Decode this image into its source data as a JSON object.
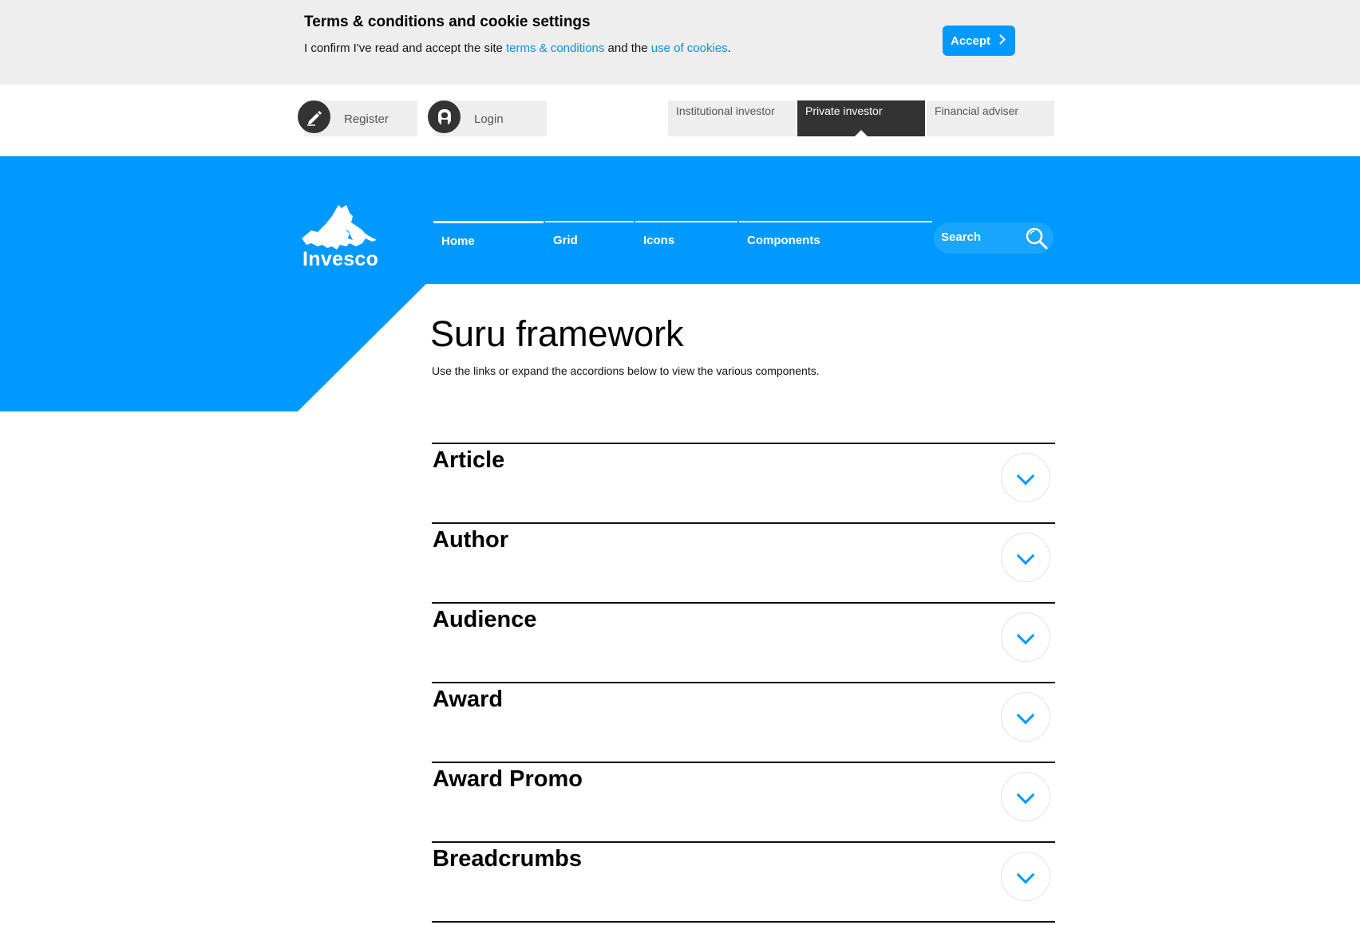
{
  "cookie": {
    "title": "Terms & conditions and cookie settings",
    "text_before": "I confirm I've read and accept the site ",
    "terms_link": "terms & conditions",
    "text_middle": " and the ",
    "cookies_link": "use of cookies",
    "text_after": ".",
    "accept_label": "Accept"
  },
  "user": {
    "register_label": "Register",
    "login_label": "Login"
  },
  "audience": [
    {
      "label": "Institutional investor",
      "active": false
    },
    {
      "label": "Private investor",
      "active": true
    },
    {
      "label": "Financial adviser",
      "active": false
    }
  ],
  "brand": {
    "name": "Invesco",
    "color": "#0099ff"
  },
  "nav": {
    "items": [
      "Home",
      "Grid",
      "Icons",
      "Components"
    ],
    "active": "Home"
  },
  "search": {
    "label": "Search"
  },
  "main": {
    "title": "Suru framework",
    "subtitle": "Use the links or expand the accordions below to view the various components."
  },
  "accordions": [
    "Article",
    "Author",
    "Audience",
    "Award",
    "Award Promo",
    "Breadcrumbs"
  ]
}
